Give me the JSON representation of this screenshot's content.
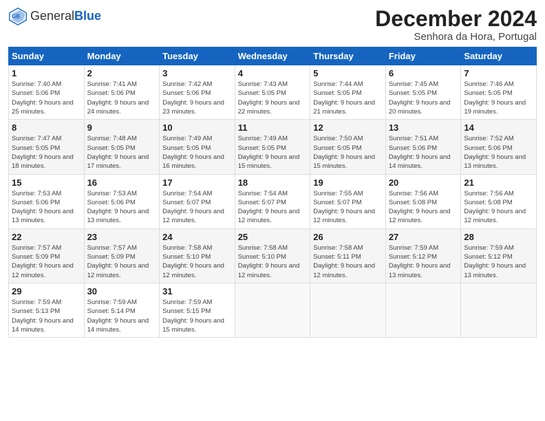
{
  "header": {
    "logo_general": "General",
    "logo_blue": "Blue",
    "month_title": "December 2024",
    "location": "Senhora da Hora, Portugal"
  },
  "weekdays": [
    "Sunday",
    "Monday",
    "Tuesday",
    "Wednesday",
    "Thursday",
    "Friday",
    "Saturday"
  ],
  "weeks": [
    [
      {
        "day": "1",
        "sunrise": "Sunrise: 7:40 AM",
        "sunset": "Sunset: 5:06 PM",
        "daylight": "Daylight: 9 hours and 25 minutes."
      },
      {
        "day": "2",
        "sunrise": "Sunrise: 7:41 AM",
        "sunset": "Sunset: 5:06 PM",
        "daylight": "Daylight: 9 hours and 24 minutes."
      },
      {
        "day": "3",
        "sunrise": "Sunrise: 7:42 AM",
        "sunset": "Sunset: 5:06 PM",
        "daylight": "Daylight: 9 hours and 23 minutes."
      },
      {
        "day": "4",
        "sunrise": "Sunrise: 7:43 AM",
        "sunset": "Sunset: 5:05 PM",
        "daylight": "Daylight: 9 hours and 22 minutes."
      },
      {
        "day": "5",
        "sunrise": "Sunrise: 7:44 AM",
        "sunset": "Sunset: 5:05 PM",
        "daylight": "Daylight: 9 hours and 21 minutes."
      },
      {
        "day": "6",
        "sunrise": "Sunrise: 7:45 AM",
        "sunset": "Sunset: 5:05 PM",
        "daylight": "Daylight: 9 hours and 20 minutes."
      },
      {
        "day": "7",
        "sunrise": "Sunrise: 7:46 AM",
        "sunset": "Sunset: 5:05 PM",
        "daylight": "Daylight: 9 hours and 19 minutes."
      }
    ],
    [
      {
        "day": "8",
        "sunrise": "Sunrise: 7:47 AM",
        "sunset": "Sunset: 5:05 PM",
        "daylight": "Daylight: 9 hours and 18 minutes."
      },
      {
        "day": "9",
        "sunrise": "Sunrise: 7:48 AM",
        "sunset": "Sunset: 5:05 PM",
        "daylight": "Daylight: 9 hours and 17 minutes."
      },
      {
        "day": "10",
        "sunrise": "Sunrise: 7:49 AM",
        "sunset": "Sunset: 5:05 PM",
        "daylight": "Daylight: 9 hours and 16 minutes."
      },
      {
        "day": "11",
        "sunrise": "Sunrise: 7:49 AM",
        "sunset": "Sunset: 5:05 PM",
        "daylight": "Daylight: 9 hours and 15 minutes."
      },
      {
        "day": "12",
        "sunrise": "Sunrise: 7:50 AM",
        "sunset": "Sunset: 5:05 PM",
        "daylight": "Daylight: 9 hours and 15 minutes."
      },
      {
        "day": "13",
        "sunrise": "Sunrise: 7:51 AM",
        "sunset": "Sunset: 5:06 PM",
        "daylight": "Daylight: 9 hours and 14 minutes."
      },
      {
        "day": "14",
        "sunrise": "Sunrise: 7:52 AM",
        "sunset": "Sunset: 5:06 PM",
        "daylight": "Daylight: 9 hours and 13 minutes."
      }
    ],
    [
      {
        "day": "15",
        "sunrise": "Sunrise: 7:53 AM",
        "sunset": "Sunset: 5:06 PM",
        "daylight": "Daylight: 9 hours and 13 minutes."
      },
      {
        "day": "16",
        "sunrise": "Sunrise: 7:53 AM",
        "sunset": "Sunset: 5:06 PM",
        "daylight": "Daylight: 9 hours and 13 minutes."
      },
      {
        "day": "17",
        "sunrise": "Sunrise: 7:54 AM",
        "sunset": "Sunset: 5:07 PM",
        "daylight": "Daylight: 9 hours and 12 minutes."
      },
      {
        "day": "18",
        "sunrise": "Sunrise: 7:54 AM",
        "sunset": "Sunset: 5:07 PM",
        "daylight": "Daylight: 9 hours and 12 minutes."
      },
      {
        "day": "19",
        "sunrise": "Sunrise: 7:55 AM",
        "sunset": "Sunset: 5:07 PM",
        "daylight": "Daylight: 9 hours and 12 minutes."
      },
      {
        "day": "20",
        "sunrise": "Sunrise: 7:56 AM",
        "sunset": "Sunset: 5:08 PM",
        "daylight": "Daylight: 9 hours and 12 minutes."
      },
      {
        "day": "21",
        "sunrise": "Sunrise: 7:56 AM",
        "sunset": "Sunset: 5:08 PM",
        "daylight": "Daylight: 9 hours and 12 minutes."
      }
    ],
    [
      {
        "day": "22",
        "sunrise": "Sunrise: 7:57 AM",
        "sunset": "Sunset: 5:09 PM",
        "daylight": "Daylight: 9 hours and 12 minutes."
      },
      {
        "day": "23",
        "sunrise": "Sunrise: 7:57 AM",
        "sunset": "Sunset: 5:09 PM",
        "daylight": "Daylight: 9 hours and 12 minutes."
      },
      {
        "day": "24",
        "sunrise": "Sunrise: 7:58 AM",
        "sunset": "Sunset: 5:10 PM",
        "daylight": "Daylight: 9 hours and 12 minutes."
      },
      {
        "day": "25",
        "sunrise": "Sunrise: 7:58 AM",
        "sunset": "Sunset: 5:10 PM",
        "daylight": "Daylight: 9 hours and 12 minutes."
      },
      {
        "day": "26",
        "sunrise": "Sunrise: 7:58 AM",
        "sunset": "Sunset: 5:11 PM",
        "daylight": "Daylight: 9 hours and 12 minutes."
      },
      {
        "day": "27",
        "sunrise": "Sunrise: 7:59 AM",
        "sunset": "Sunset: 5:12 PM",
        "daylight": "Daylight: 9 hours and 13 minutes."
      },
      {
        "day": "28",
        "sunrise": "Sunrise: 7:59 AM",
        "sunset": "Sunset: 5:12 PM",
        "daylight": "Daylight: 9 hours and 13 minutes."
      }
    ],
    [
      {
        "day": "29",
        "sunrise": "Sunrise: 7:59 AM",
        "sunset": "Sunset: 5:13 PM",
        "daylight": "Daylight: 9 hours and 14 minutes."
      },
      {
        "day": "30",
        "sunrise": "Sunrise: 7:59 AM",
        "sunset": "Sunset: 5:14 PM",
        "daylight": "Daylight: 9 hours and 14 minutes."
      },
      {
        "day": "31",
        "sunrise": "Sunrise: 7:59 AM",
        "sunset": "Sunset: 5:15 PM",
        "daylight": "Daylight: 9 hours and 15 minutes."
      },
      null,
      null,
      null,
      null
    ]
  ]
}
